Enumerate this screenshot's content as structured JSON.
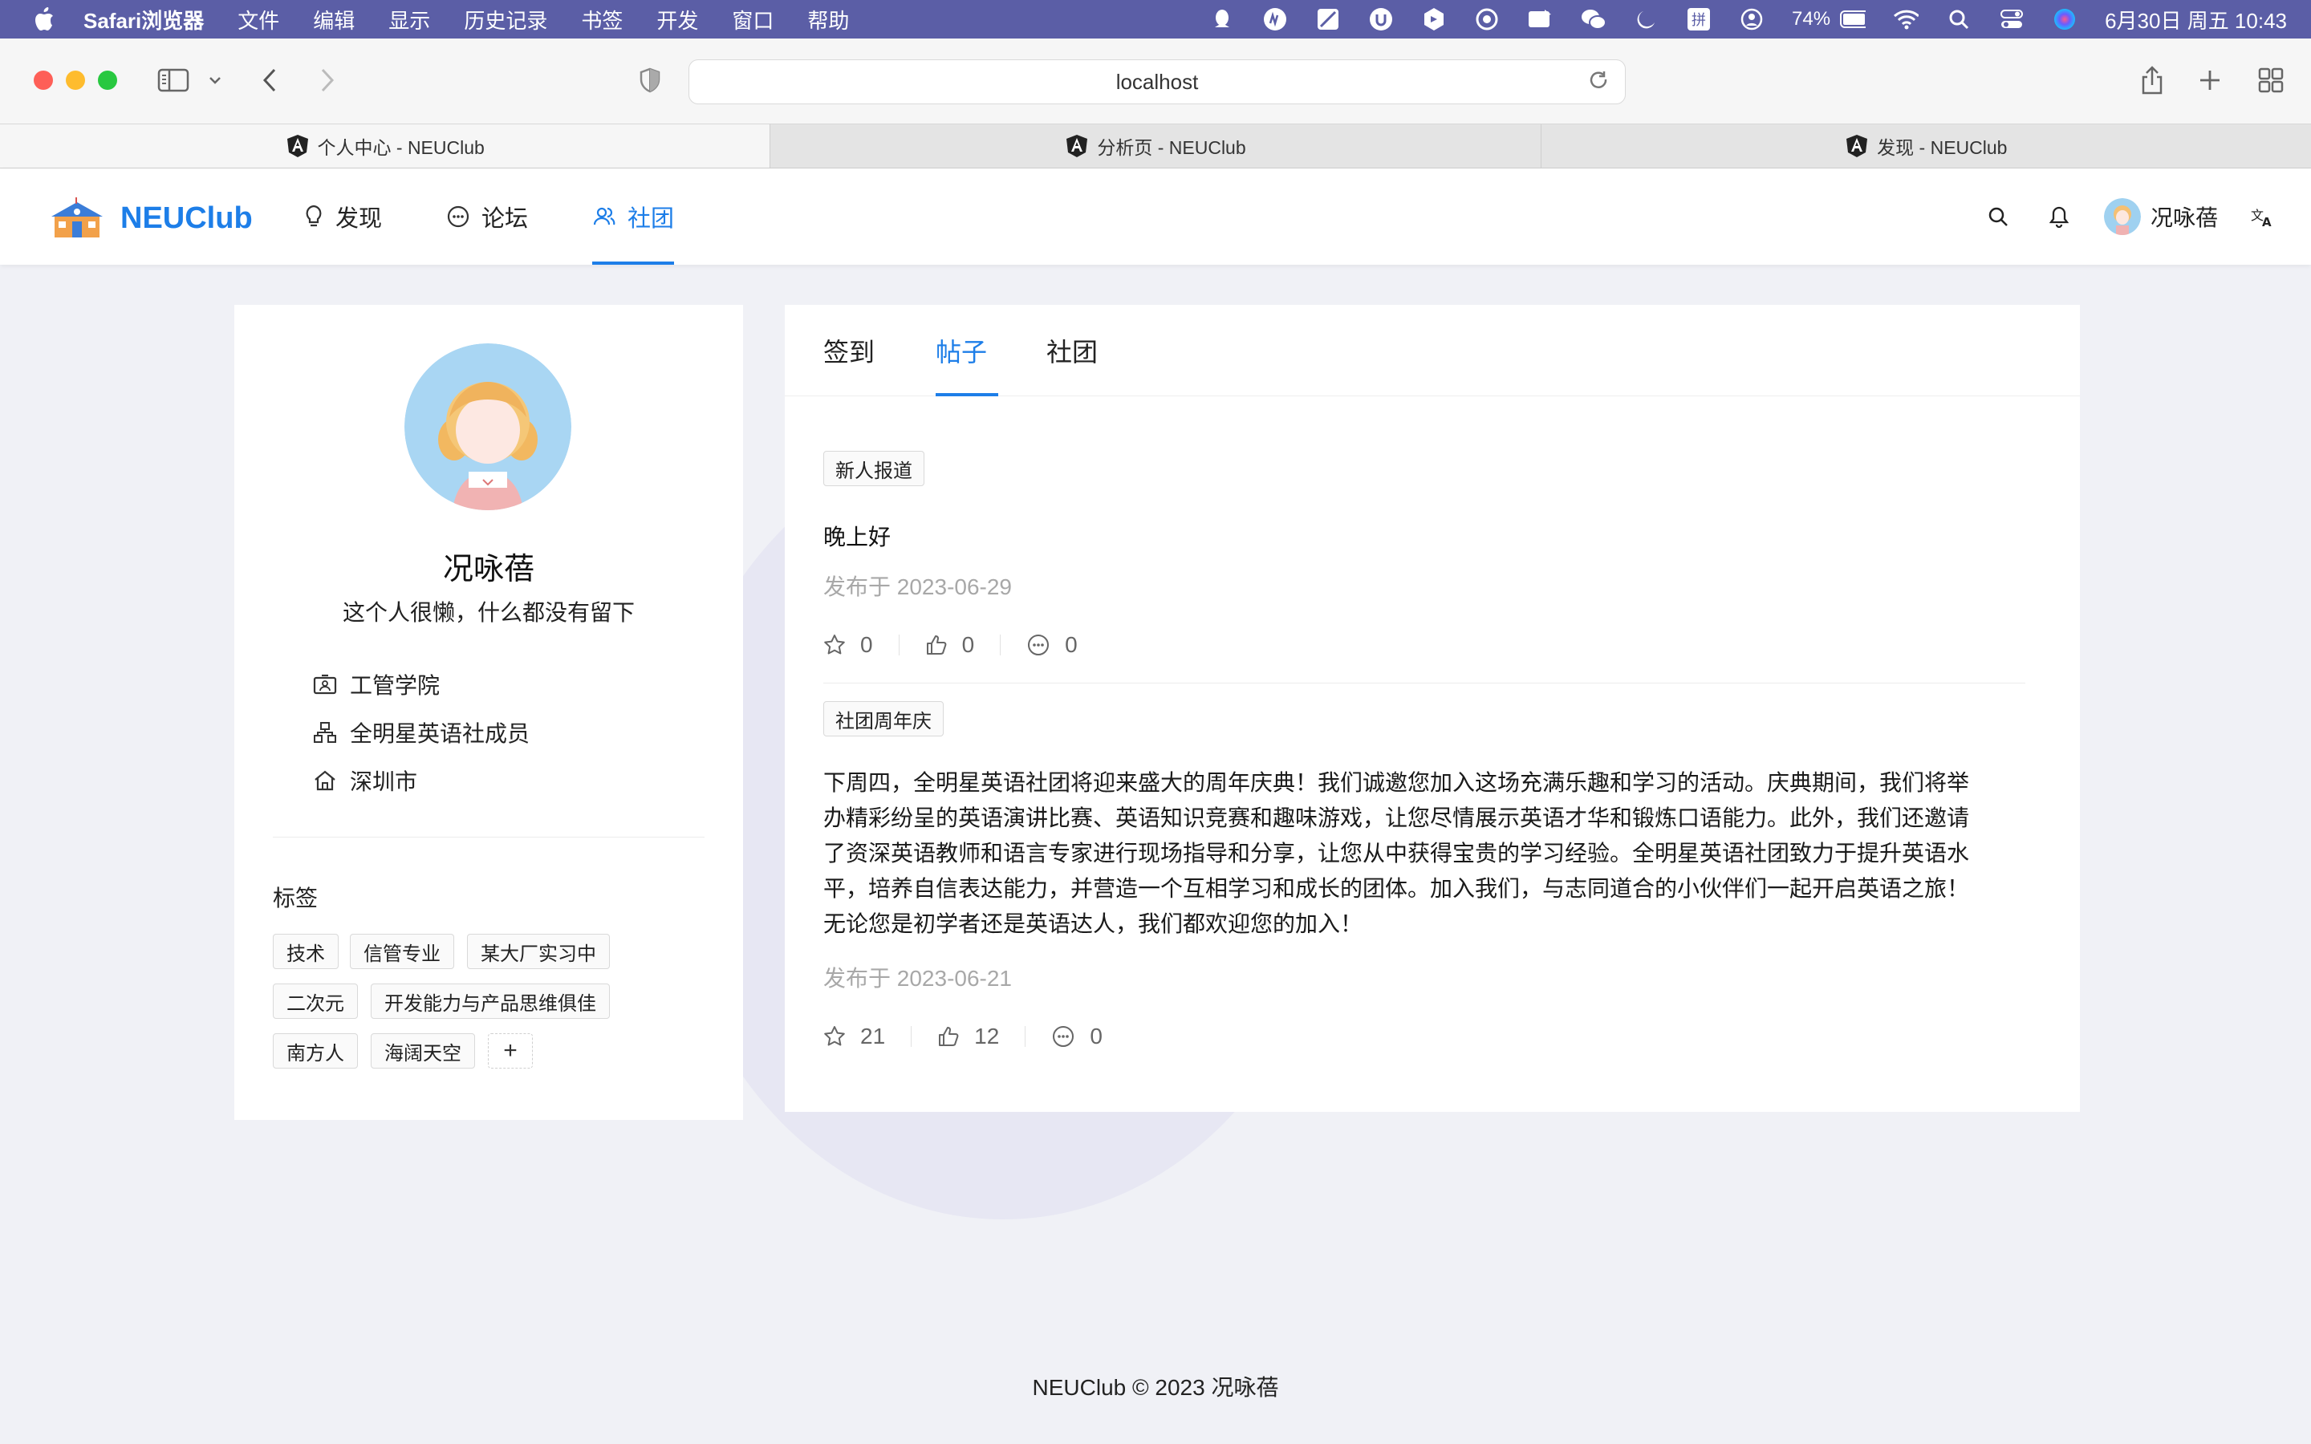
{
  "menubar": {
    "app": "Safari浏览器",
    "items": [
      "文件",
      "编辑",
      "显示",
      "历史记录",
      "书签",
      "开发",
      "窗口",
      "帮助"
    ],
    "battery": "74%",
    "datetime": "6月30日 周五  10:43"
  },
  "browser": {
    "url": "localhost",
    "tabs": [
      {
        "title": "个人中心 - NEUClub"
      },
      {
        "title": "分析页 - NEUClub"
      },
      {
        "title": "发现 - NEUClub"
      }
    ]
  },
  "header": {
    "brand": "NEUClub",
    "nav": [
      {
        "label": "发现",
        "icon": "bulb-icon"
      },
      {
        "label": "论坛",
        "icon": "chat-bubble-icon"
      },
      {
        "label": "社团",
        "icon": "team-icon"
      }
    ],
    "user_name": "况咏蓓"
  },
  "profile": {
    "name": "况咏蓓",
    "bio": "这个人很懒，什么都没有留下",
    "college": "工管学院",
    "club": "全明星英语社成员",
    "city": "深圳市",
    "tags_title": "标签",
    "tags": [
      "技术",
      "信管专业",
      "某大厂实习中",
      "二次元",
      "开发能力与产品思维俱佳",
      "南方人",
      "海阔天空"
    ],
    "add_tag": "+"
  },
  "content": {
    "tabs": [
      "签到",
      "帖子",
      "社团"
    ],
    "active_tab": "帖子",
    "posts": [
      {
        "tag": "新人报道",
        "text": "晚上好",
        "date": "发布于 2023-06-29",
        "stars": "0",
        "likes": "0",
        "comments": "0"
      },
      {
        "tag": "社团周年庆",
        "text": "下周四，全明星英语社团将迎来盛大的周年庆典！我们诚邀您加入这场充满乐趣和学习的活动。庆典期间，我们将举办精彩纷呈的英语演讲比赛、英语知识竞赛和趣味游戏，让您尽情展示英语才华和锻炼口语能力。此外，我们还邀请了资深英语教师和语言专家进行现场指导和分享，让您从中获得宝贵的学习经验。全明星英语社团致力于提升英语水平，培养自信表达能力，并营造一个互相学习和成长的团体。加入我们，与志同道合的小伙伴们一起开启英语之旅！无论您是初学者还是英语达人，我们都欢迎您的加入！",
        "date": "发布于 2023-06-21",
        "stars": "21",
        "likes": "12",
        "comments": "0"
      }
    ]
  },
  "footer": {
    "text": "NEUClub © 2023 况咏蓓"
  },
  "colors": {
    "accent": "#1d7ee8",
    "menubar": "#5b5ea6",
    "page_bg": "#f0f1f6"
  }
}
